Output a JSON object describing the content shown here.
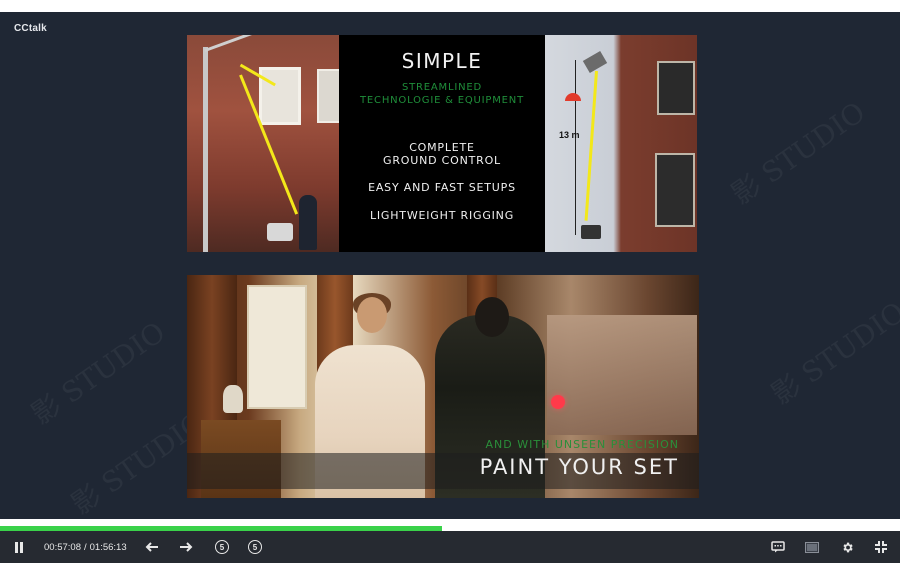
{
  "app": {
    "title": "CCtalk"
  },
  "watermark": {
    "text": "影 STUDIO"
  },
  "slide_top": {
    "heading": "SIMPLE",
    "subheading_line1": "STREAMLINED",
    "subheading_line2": "TECHNOLOGIE & EQUIPMENT",
    "features": [
      "COMPLETE",
      "GROUND CONTROL",
      "EASY AND FAST SETUPS",
      "LIGHTWEIGHT RIGGING"
    ],
    "dimension_label": "13 m"
  },
  "slide_bottom": {
    "caption_sub": "AND WITH UNSEEN PRECISION",
    "caption_main": "PAINT YOUR SET"
  },
  "player": {
    "current_time": "00:57:08",
    "separator": "/",
    "total_time": "01:56:13",
    "progress_fraction": 0.491,
    "skip_back_label": "5",
    "skip_forward_label": "5",
    "accent_color": "#3ad24a",
    "icons": [
      "pause-icon",
      "previous-arrow-icon",
      "next-arrow-icon",
      "rewind-5-icon",
      "forward-5-icon",
      "subtitles-icon",
      "picture-in-picture-icon",
      "settings-icon",
      "exit-fullscreen-icon"
    ]
  }
}
